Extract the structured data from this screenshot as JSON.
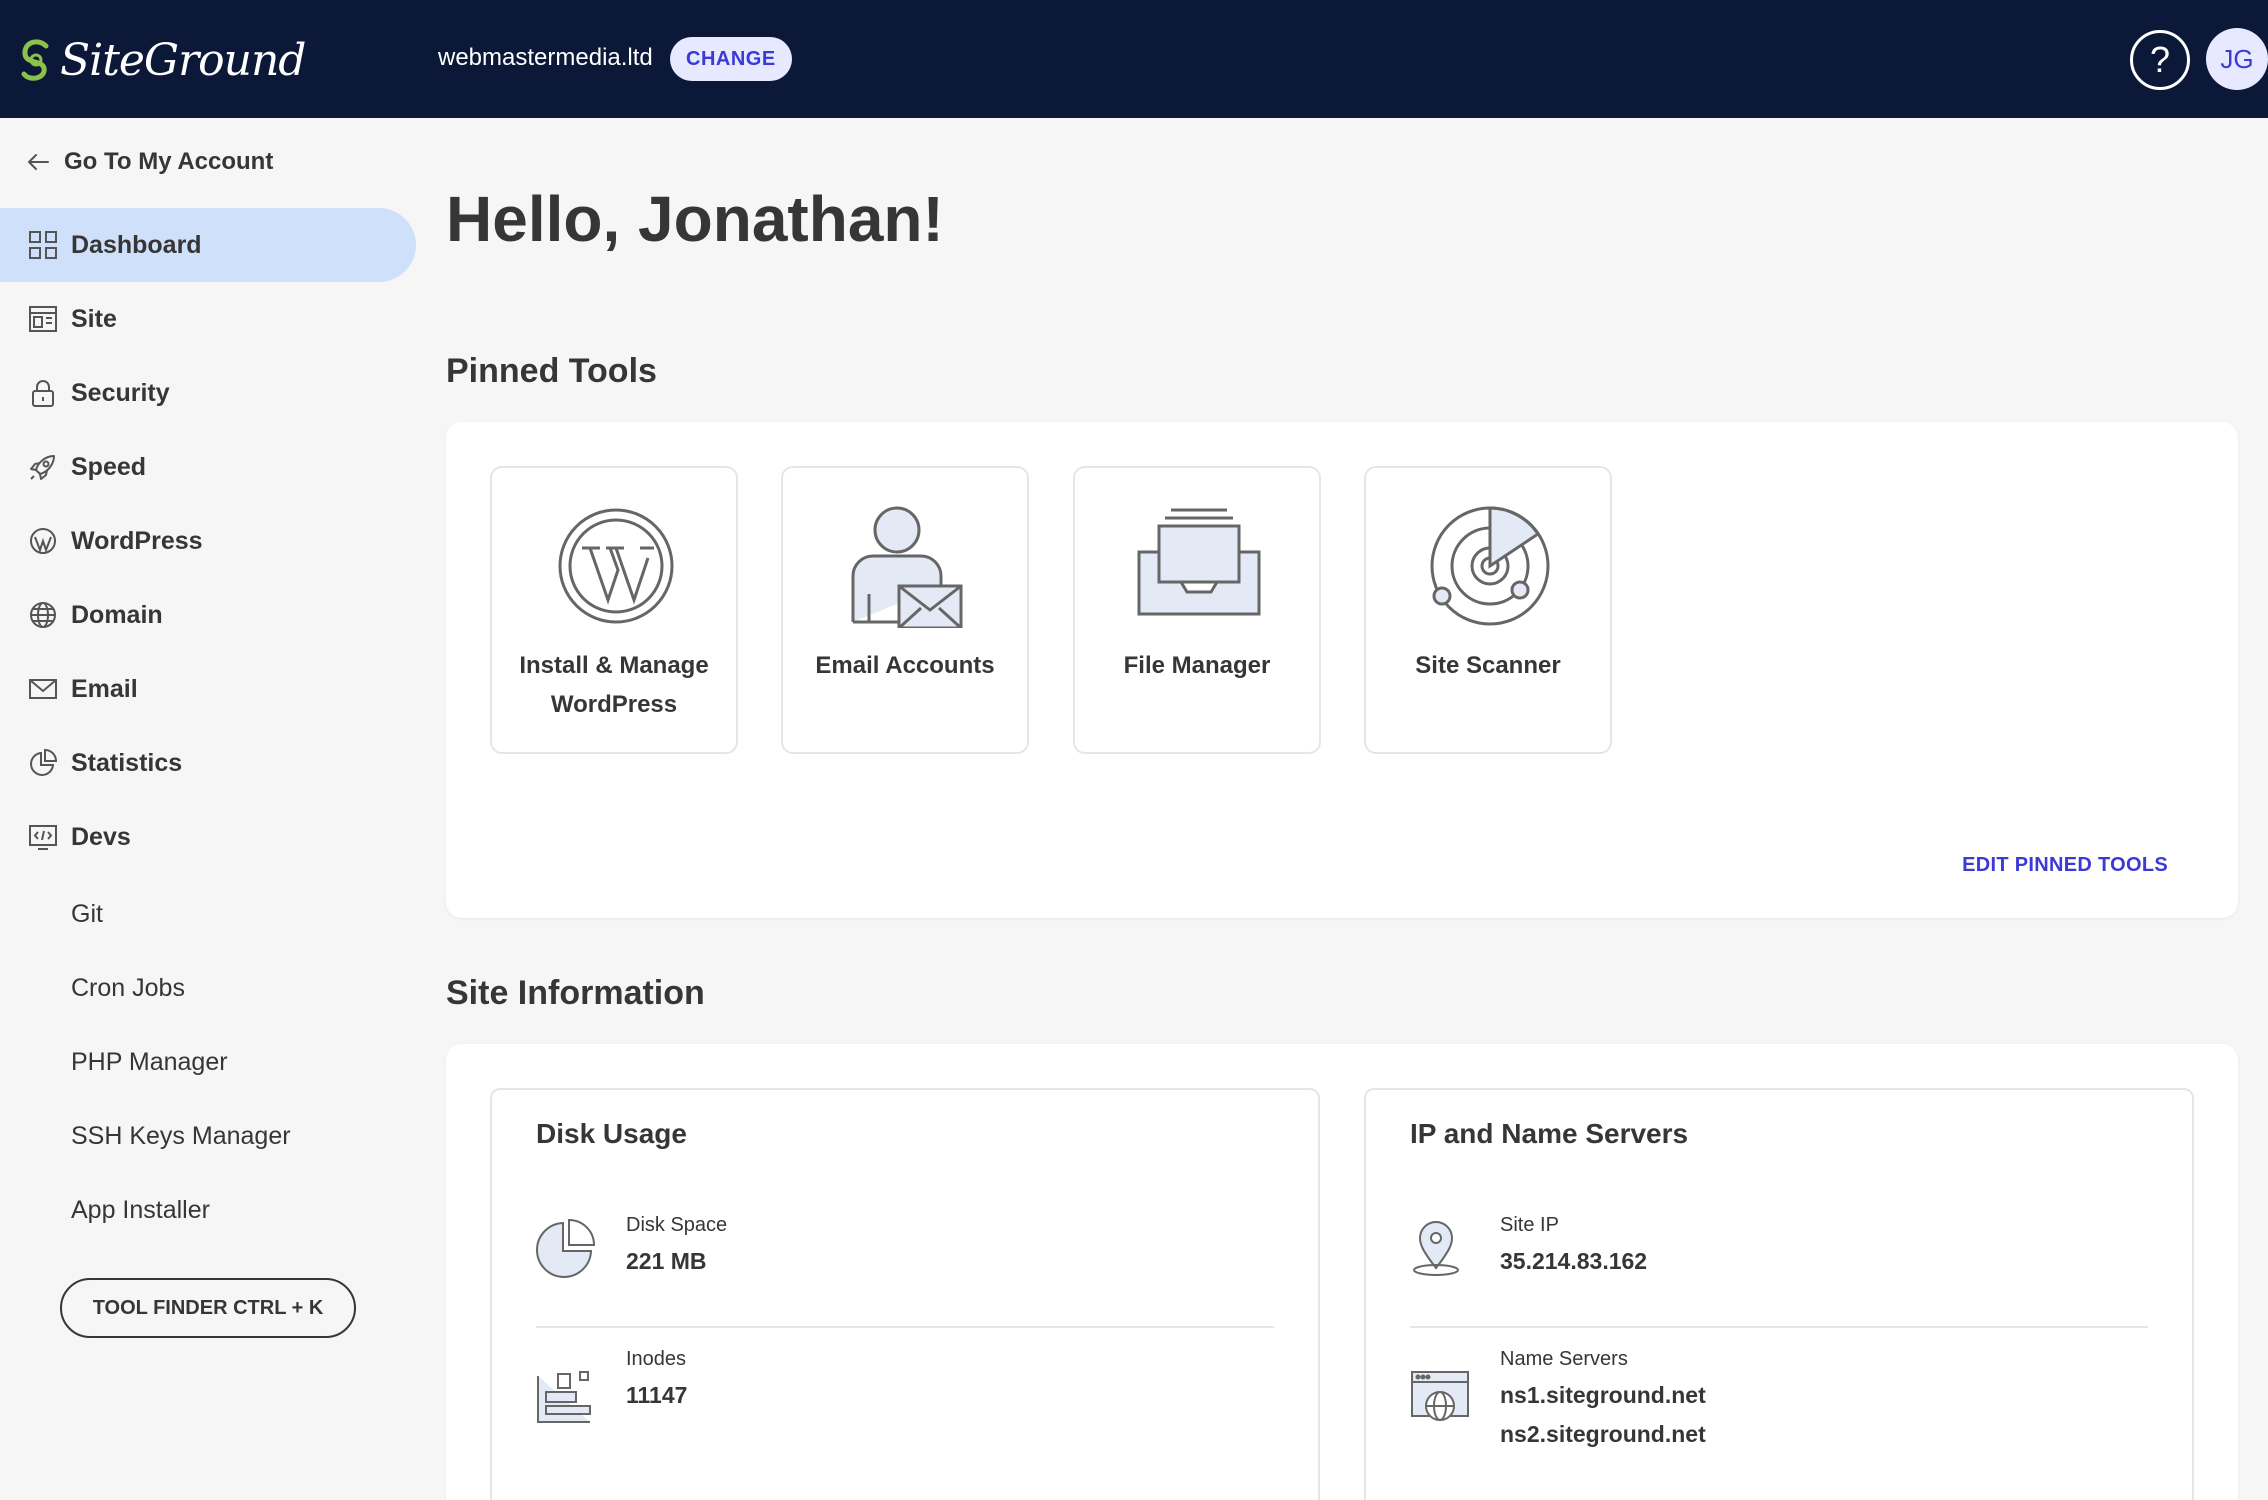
{
  "header": {
    "logo_text": "SiteGround",
    "site_name": "webmastermedia.ltd",
    "change_label": "CHANGE",
    "help_label": "?",
    "avatar_initials": "JG"
  },
  "sidebar": {
    "back_label": "Go To My Account",
    "items": [
      {
        "label": "Dashboard",
        "icon": "dashboard-icon",
        "active": true
      },
      {
        "label": "Site",
        "icon": "site-icon"
      },
      {
        "label": "Security",
        "icon": "lock-icon"
      },
      {
        "label": "Speed",
        "icon": "rocket-icon"
      },
      {
        "label": "WordPress",
        "icon": "wordpress-icon"
      },
      {
        "label": "Domain",
        "icon": "globe-icon"
      },
      {
        "label": "Email",
        "icon": "envelope-icon"
      },
      {
        "label": "Statistics",
        "icon": "pie-chart-icon"
      },
      {
        "label": "Devs",
        "icon": "code-icon"
      }
    ],
    "sub_items": [
      "Git",
      "Cron Jobs",
      "PHP Manager",
      "SSH Keys Manager",
      "App Installer"
    ],
    "tool_finder_label": "TOOL FINDER CTRL + K"
  },
  "main": {
    "greeting": "Hello, Jonathan!",
    "pinned_title": "Pinned Tools",
    "pinned_tools": [
      {
        "label": "Install & Manage WordPress",
        "icon": "wordpress-icon"
      },
      {
        "label": "Email Accounts",
        "icon": "email-accounts-icon"
      },
      {
        "label": "File Manager",
        "icon": "file-manager-icon"
      },
      {
        "label": "Site Scanner",
        "icon": "radar-icon"
      }
    ],
    "edit_pinned_label": "EDIT PINNED TOOLS",
    "site_info_title": "Site Information",
    "disk_usage": {
      "title": "Disk Usage",
      "disk_space_label": "Disk Space",
      "disk_space_value": "221 MB",
      "inodes_label": "Inodes",
      "inodes_value": "11147"
    },
    "servers": {
      "title": "IP and Name Servers",
      "site_ip_label": "Site IP",
      "site_ip_value": "35.214.83.162",
      "name_servers_label": "Name Servers",
      "ns1": "ns1.siteground.net",
      "ns2": "ns2.siteground.net"
    }
  },
  "colors": {
    "topbar": "#0c1838",
    "accent": "#3b3ad6",
    "active_nav": "#cfe0fa",
    "logo_green": "#8bc34a"
  }
}
